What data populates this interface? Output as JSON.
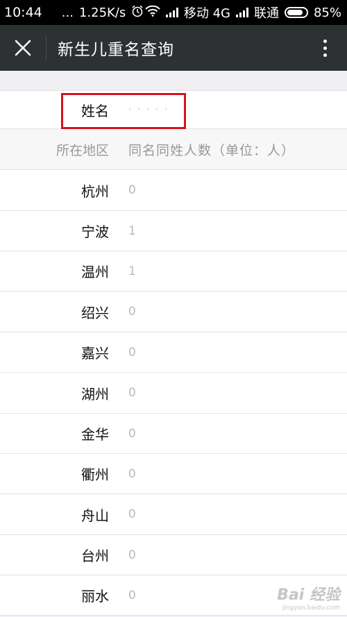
{
  "status_bar": {
    "time": "10:44",
    "dots": "...",
    "speed": "1.25K/s",
    "carrier1": "移动 4G",
    "carrier2": "联通",
    "battery": "85%"
  },
  "nav": {
    "title": "新生儿重名查询"
  },
  "form": {
    "name_label": "姓名",
    "name_value": "· · · · ·"
  },
  "table": {
    "headers": [
      "所在地区",
      "同名同姓人数（单位：人）"
    ],
    "rows": [
      {
        "region": "杭州",
        "count": "0"
      },
      {
        "region": "宁波",
        "count": "1"
      },
      {
        "region": "温州",
        "count": "1"
      },
      {
        "region": "绍兴",
        "count": "0"
      },
      {
        "region": "嘉兴",
        "count": "0"
      },
      {
        "region": "湖州",
        "count": "0"
      },
      {
        "region": "金华",
        "count": "0"
      },
      {
        "region": "衢州",
        "count": "0"
      },
      {
        "region": "舟山",
        "count": "0"
      },
      {
        "region": "台州",
        "count": "0"
      },
      {
        "region": "丽水",
        "count": "0"
      }
    ]
  },
  "watermark": {
    "brand": "Bai 经验",
    "site": "jingyan.baidu.com"
  },
  "colors": {
    "nav_bg": "#2e3134",
    "highlight": "#d8121b"
  }
}
